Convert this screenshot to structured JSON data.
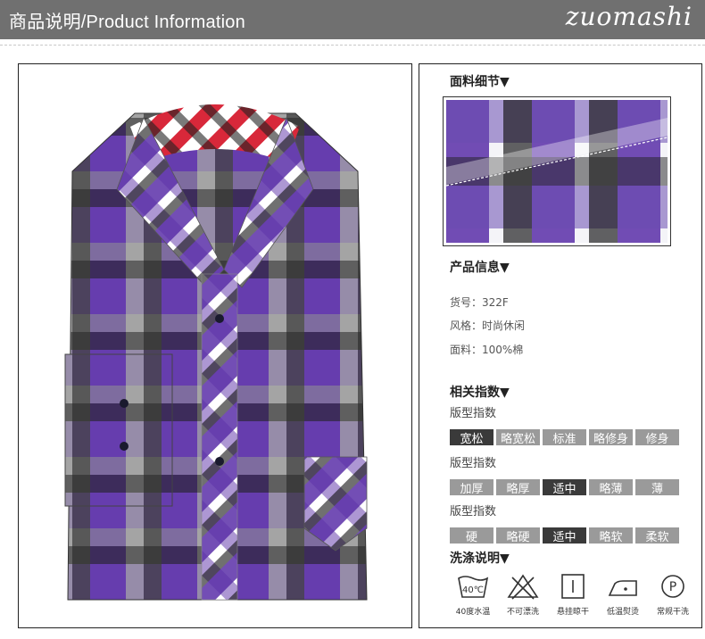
{
  "header": {
    "title": "商品说明/Product Information",
    "brand": "zuomashi"
  },
  "fabric_section": {
    "title": "面料细节▼"
  },
  "product_info": {
    "title": "产品信息▼",
    "lines": [
      "货号：322F",
      "风格：时尚休闲",
      "面料：100%棉"
    ]
  },
  "indices": {
    "title": "相关指数▼",
    "rows": [
      {
        "label": "版型指数",
        "options": [
          "宽松",
          "略宽松",
          "标准",
          "略修身",
          "修身"
        ],
        "active": 0
      },
      {
        "label": "版型指数",
        "options": [
          "加厚",
          "略厚",
          "适中",
          "略薄",
          "薄"
        ],
        "active": 2
      },
      {
        "label": "版型指数",
        "options": [
          "硬",
          "略硬",
          "适中",
          "略软",
          "柔软"
        ],
        "active": 2
      }
    ]
  },
  "care": {
    "title": "洗涤说明▼",
    "items": [
      {
        "icon": "wash-40-icon",
        "label": "40度水温",
        "symbol": "40℃"
      },
      {
        "icon": "no-bleach-icon",
        "label": "不可漂洗"
      },
      {
        "icon": "hang-dry-icon",
        "label": "悬挂晾干"
      },
      {
        "icon": "iron-low-icon",
        "label": "低温熨烫"
      },
      {
        "icon": "dry-clean-icon",
        "label": "常规干洗",
        "symbol": "P"
      }
    ]
  },
  "colors": {
    "purple": "#5b2fa8",
    "lavender": "#b7a6dc",
    "dark": "#222222",
    "red": "#d8283a",
    "header_gray": "#707070"
  }
}
